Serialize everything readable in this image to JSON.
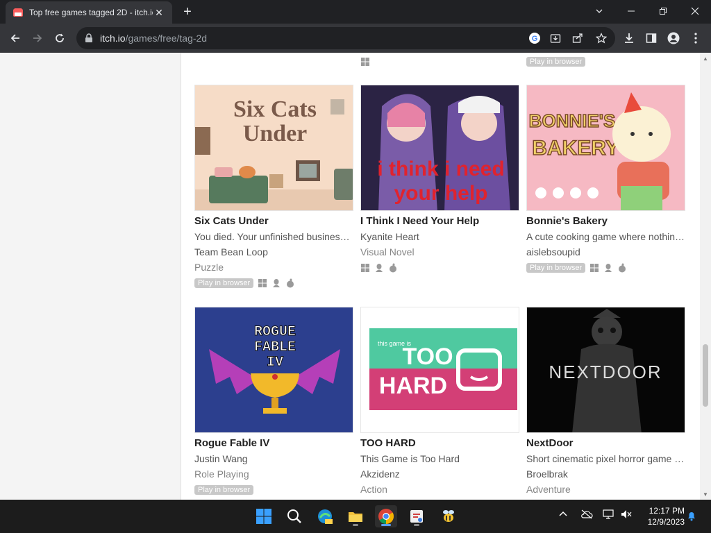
{
  "browser": {
    "tab_title": "Top free games tagged 2D - itch.io",
    "tab_close": "✕",
    "new_tab": "+",
    "url_host": "itch.io",
    "url_path": "/games/free/tag-2d"
  },
  "top_strip": {
    "left_platform": "windows",
    "right_badge": "Play in browser"
  },
  "games": [
    {
      "title": "Six Cats Under",
      "desc": "You died. Your unfinished business? ...",
      "author": "Team Bean Loop",
      "genre": "Puzzle",
      "badge": "Play in browser",
      "platforms": [
        "windows",
        "linux",
        "apple"
      ],
      "art": "six-cats-under-cover"
    },
    {
      "title": "I Think I Need Your Help",
      "desc": "",
      "author": "Kyanite Heart",
      "genre": "Visual Novel",
      "badge": "",
      "platforms": [
        "windows",
        "linux",
        "apple"
      ],
      "art": "i-think-i-need-your-help-cover"
    },
    {
      "title": "Bonnie's Bakery",
      "desc": "A cute cooking game where nothing...",
      "author": "aislebsoupid",
      "genre": "",
      "badge": "Play in browser",
      "platforms": [
        "windows",
        "linux",
        "apple"
      ],
      "art": "bonnies-bakery-cover"
    },
    {
      "title": "Rogue Fable IV",
      "desc": "",
      "author": "Justin Wang",
      "genre": "Role Playing",
      "badge": "Play in browser",
      "platforms": [],
      "art": "rogue-fable-iv-cover"
    },
    {
      "title": "TOO HARD",
      "desc": "This Game is Too Hard",
      "author": "Akzidenz",
      "genre": "Action",
      "badge": "",
      "platforms": [],
      "art": "too-hard-cover"
    },
    {
      "title": "NextDoor",
      "desc": "Short cinematic pixel horror game b...",
      "author": "Broelbrak",
      "genre": "Adventure",
      "badge": "",
      "platforms": [],
      "art": "nextdoor-cover"
    }
  ],
  "art_text": {
    "six_cats_line1": "Six Cats",
    "six_cats_line2": "Under",
    "help_line1": "i think i need",
    "help_line2": "your help",
    "bonnie_line1": "BONNIE'S",
    "bonnie_line2": "BAKERY",
    "rogue_line1": "ROGUE",
    "rogue_line2": "FABLE",
    "rogue_line3": "IV",
    "toohard_small": "this game is",
    "toohard_line1": "TOO",
    "toohard_line2": "HARD",
    "nextdoor": "NEXTDOOR"
  },
  "taskbar": {
    "time": "12:17 PM",
    "date": "12/9/2023"
  },
  "colors": {
    "browser_bg": "#202124",
    "toolbar_bg": "#35363a",
    "taskbar_bg": "#1c1c1c",
    "badge_bg": "#c8c8c8"
  }
}
